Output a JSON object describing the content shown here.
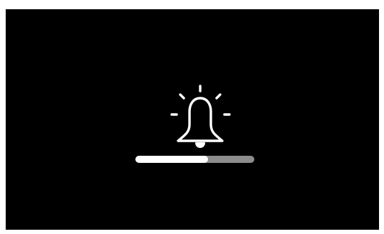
{
  "overlay": {
    "icon": "bell-icon",
    "background_color": "#000000",
    "foreground_color": "#ffffff"
  },
  "progress": {
    "value": 0.61,
    "fill_color": "#ffffff",
    "track_color": "#8c8c8c"
  }
}
